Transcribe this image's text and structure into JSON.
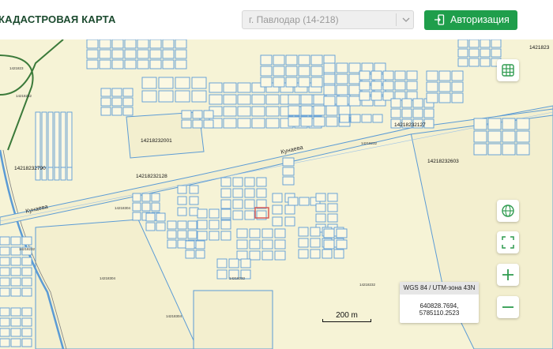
{
  "header": {
    "title": "КАДАСТРОВАЯ КАРТА",
    "region_select": {
      "value": "г. Павлодар (14-218)"
    },
    "login_label": "Авторизация"
  },
  "map": {
    "parcel_labels": [
      "14218232001",
      "14218232790",
      "14218232603",
      "14218232127",
      "14218232128",
      "1421823"
    ],
    "small_labels": [
      "14218232",
      "14218304",
      "14218232",
      "14218232",
      "14218304",
      "14218304",
      "14218232",
      "14218232",
      "1421823"
    ],
    "streets": [
      "Кунаева",
      "Кунаева"
    ]
  },
  "coords": {
    "crs": "WGS 84 / UTM-зона 43N",
    "x": "640828.7694,",
    "y": "5785110.2523"
  },
  "scale": {
    "label": "200 m"
  },
  "colors": {
    "accent_green": "#1f9e4b",
    "parcel_outline": "#5b9bd5",
    "selected_parcel": "#d9534f",
    "map_background": "#f6f3d6"
  }
}
